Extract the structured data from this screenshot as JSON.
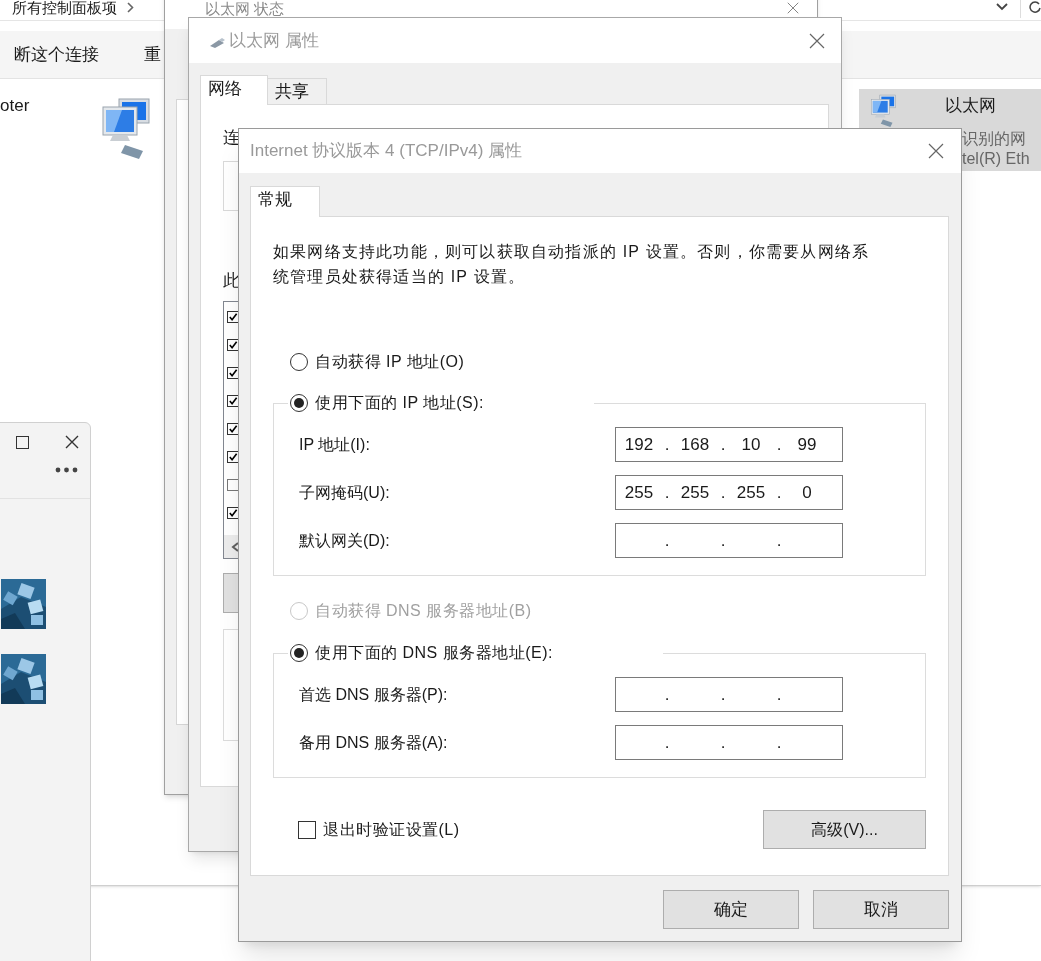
{
  "explorer": {
    "breadcrumb": "所有控制面板项",
    "toolbar": [
      "断这个连接",
      "重"
    ],
    "items": [
      {
        "title": "oter",
        "selected": false
      },
      {
        "title": "以太网",
        "details": [
          "识别的网",
          "tel(R) Eth"
        ],
        "selected": true
      }
    ]
  },
  "status_window": {
    "title": "以太网 状态"
  },
  "properties_window": {
    "title": "以太网 属性",
    "tabs": [
      {
        "label": "网络",
        "selected": true
      },
      {
        "label": "共享",
        "selected": false
      }
    ],
    "labels": [
      "连",
      "此"
    ],
    "components": [
      {
        "checked": true
      },
      {
        "checked": true
      },
      {
        "checked": true
      },
      {
        "checked": true
      },
      {
        "checked": true
      },
      {
        "checked": true
      },
      {
        "checked": false
      },
      {
        "checked": true
      }
    ]
  },
  "ipv4_dialog": {
    "title": "Internet 协议版本 4 (TCP/IPv4) 属性",
    "tabs": [
      {
        "label": "常规",
        "selected": true
      }
    ],
    "description": "如果网络支持此功能，则可以获取自动指派的 IP 设置。否则，你需要从网络系统管理员处获得适当的 IP 设置。",
    "octet_separator": ".",
    "ip_mode": [
      {
        "label": "自动获得 IP 地址(O)",
        "selected": false,
        "disabled": false
      },
      {
        "label": "使用下面的 IP 地址(S):",
        "selected": true,
        "disabled": false
      }
    ],
    "ip_fields": [
      {
        "label": "IP 地址(I):",
        "octets": [
          "192",
          "168",
          "10",
          "99"
        ]
      },
      {
        "label": "子网掩码(U):",
        "octets": [
          "255",
          "255",
          "255",
          "0"
        ]
      },
      {
        "label": "默认网关(D):"
      }
    ],
    "dns_mode": [
      {
        "label": "自动获得 DNS 服务器地址(B)",
        "selected": false,
        "disabled": true
      },
      {
        "label": "使用下面的 DNS 服务器地址(E):",
        "selected": true,
        "disabled": false
      }
    ],
    "dns_fields": [
      {
        "label": "首选 DNS 服务器(P):"
      },
      {
        "label": "备用 DNS 服务器(A):"
      }
    ],
    "validate": {
      "label": "退出时验证设置(L)",
      "checked": false
    },
    "advanced_button": "高级(V)...",
    "buttons": [
      "确定",
      "取消"
    ]
  }
}
